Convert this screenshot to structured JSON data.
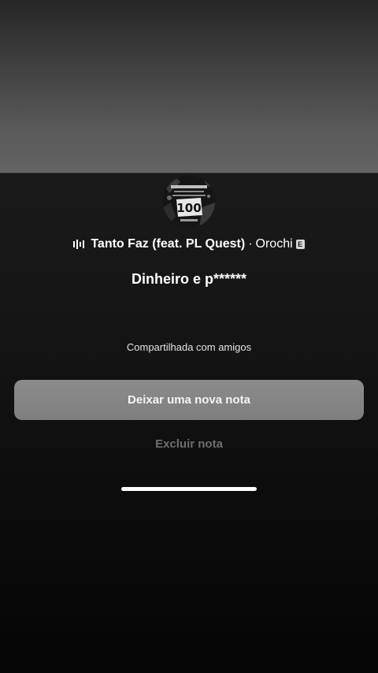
{
  "sheet": {
    "song": {
      "title": "Tanto Faz (feat. PL Quest)",
      "separator": "·",
      "artist": "Orochi",
      "explicit_badge": "E"
    },
    "cover_art_text": "100",
    "note_text": "Dinheiro e p******",
    "audience": "Compartilhada com amigos",
    "primary_action": "Deixar uma nova nota",
    "secondary_action": "Excluir nota"
  },
  "icons": {
    "now_playing": "equalizer-icon"
  },
  "colors": {
    "sheet_background": "#141414",
    "primary_button": "#858585",
    "secondary_action_text": "#6f6f6f"
  }
}
